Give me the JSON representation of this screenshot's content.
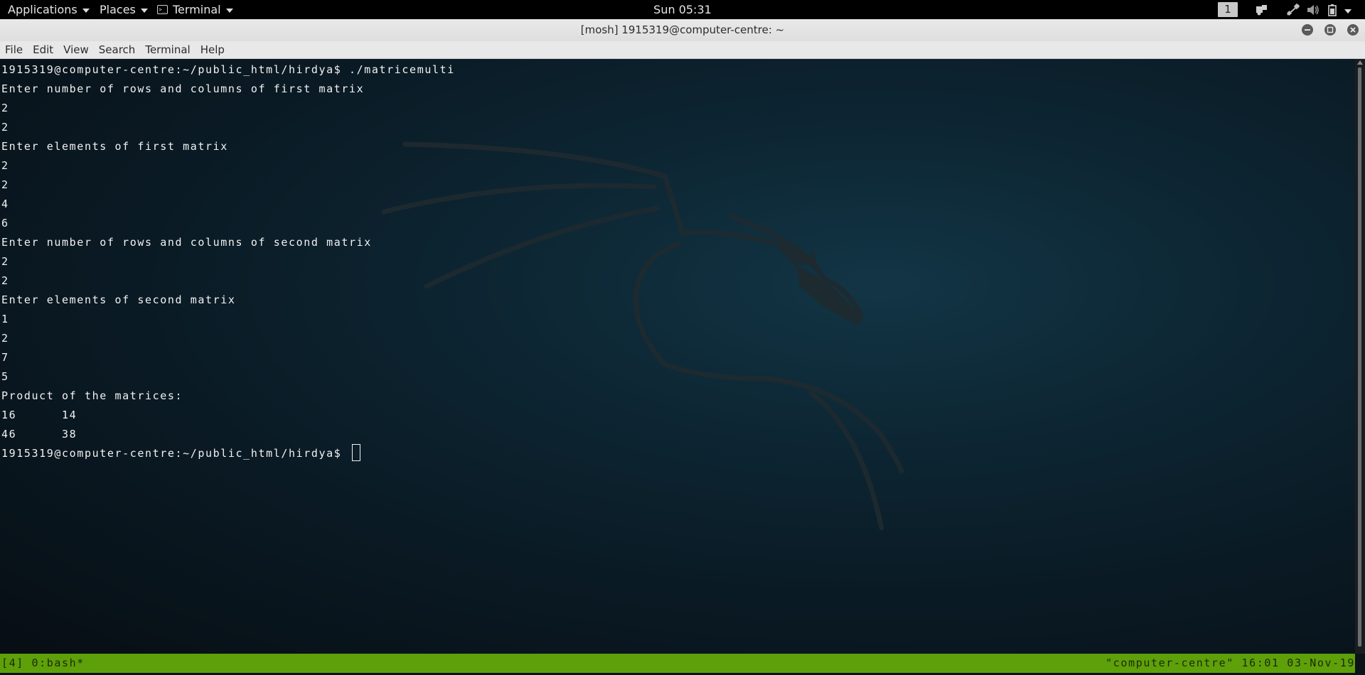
{
  "top_panel": {
    "applications_label": "Applications",
    "places_label": "Places",
    "terminal_label": "Terminal",
    "clock": "Sun 05:31",
    "workspace_number": "1",
    "tray_icons": [
      "workspaces-icon",
      "network-icon",
      "volume-icon",
      "battery-icon"
    ]
  },
  "window": {
    "title": "[mosh] 1915319@computer-centre: ~",
    "controls": [
      "minimize-icon",
      "maximize-icon",
      "close-icon"
    ]
  },
  "menubar": {
    "items": [
      "File",
      "Edit",
      "View",
      "Search",
      "Terminal",
      "Help"
    ]
  },
  "terminal": {
    "lines": [
      "1915319@computer-centre:~/public_html/hirdya$ ./matricemulti",
      "Enter number of rows and columns of first matrix",
      "2",
      "2",
      "Enter elements of first matrix",
      "2",
      "2",
      "4",
      "6",
      "Enter number of rows and columns of second matrix",
      "2",
      "2",
      "Enter elements of second matrix",
      "1",
      "2",
      "7",
      "5",
      "Product of the matrices:",
      "16\t14",
      "46\t38"
    ],
    "prompt": "1915319@computer-centre:~/public_html/hirdya$ "
  },
  "tmux": {
    "left": "[4] 0:bash*",
    "right": "\"computer-centre\" 16:01 03-Nov-19"
  },
  "colors": {
    "tmux_bg": "#5ea00a",
    "panel_bg": "#000000",
    "terminal_fg": "#f2f2f2"
  }
}
